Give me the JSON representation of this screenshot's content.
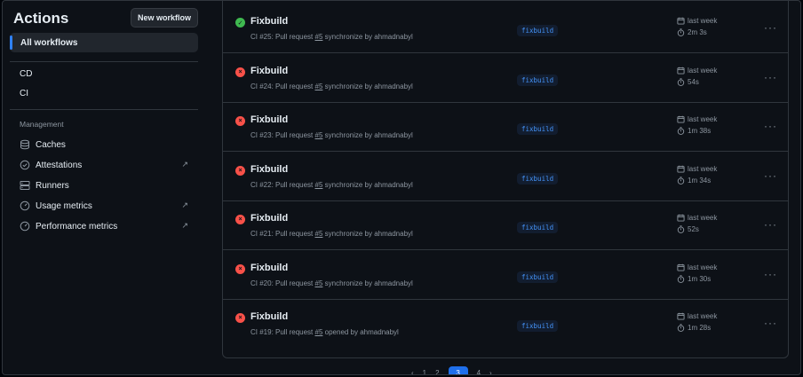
{
  "sidebar": {
    "title": "Actions",
    "new_workflow": "New workflow",
    "all_workflows": "All workflows",
    "workflows": [
      "CD",
      "CI"
    ],
    "management_label": "Management",
    "management": [
      {
        "label": "Caches",
        "icon": "database-icon",
        "external": false
      },
      {
        "label": "Attestations",
        "icon": "verified-icon",
        "external": true
      },
      {
        "label": "Runners",
        "icon": "server-icon",
        "external": false
      },
      {
        "label": "Usage metrics",
        "icon": "meter-icon",
        "external": true
      },
      {
        "label": "Performance metrics",
        "icon": "meter-icon",
        "external": true
      }
    ]
  },
  "runs": [
    {
      "name": "Fixbuild",
      "status": "success",
      "run": "CI #25: Pull request",
      "pr": "#5",
      "action": "synchronize by ahmadnabyl",
      "branch": "fixbuild",
      "when": "last week",
      "duration": "2m 3s"
    },
    {
      "name": "Fixbuild",
      "status": "failure",
      "run": "CI #24: Pull request",
      "pr": "#5",
      "action": "synchronize by ahmadnabyl",
      "branch": "fixbuild",
      "when": "last week",
      "duration": "54s"
    },
    {
      "name": "Fixbuild",
      "status": "failure",
      "run": "CI #23: Pull request",
      "pr": "#5",
      "action": "synchronize by ahmadnabyl",
      "branch": "fixbuild",
      "when": "last week",
      "duration": "1m 38s"
    },
    {
      "name": "Fixbuild",
      "status": "failure",
      "run": "CI #22: Pull request",
      "pr": "#5",
      "action": "synchronize by ahmadnabyl",
      "branch": "fixbuild",
      "when": "last week",
      "duration": "1m 34s"
    },
    {
      "name": "Fixbuild",
      "status": "failure",
      "run": "CI #21: Pull request",
      "pr": "#5",
      "action": "synchronize by ahmadnabyl",
      "branch": "fixbuild",
      "when": "last week",
      "duration": "52s"
    },
    {
      "name": "Fixbuild",
      "status": "failure",
      "run": "CI #20: Pull request",
      "pr": "#5",
      "action": "synchronize by ahmadnabyl",
      "branch": "fixbuild",
      "when": "last week",
      "duration": "1m 30s"
    },
    {
      "name": "Fixbuild",
      "status": "failure",
      "run": "CI #19: Pull request",
      "pr": "#5",
      "action": "opened by ahmadnabyl",
      "branch": "fixbuild",
      "when": "last week",
      "duration": "1m 28s"
    }
  ],
  "more_label": "···",
  "colors": {
    "accent": "#2f81f7",
    "success": "#3fb950",
    "failure": "#f85149",
    "muted": "#8d96a0"
  }
}
